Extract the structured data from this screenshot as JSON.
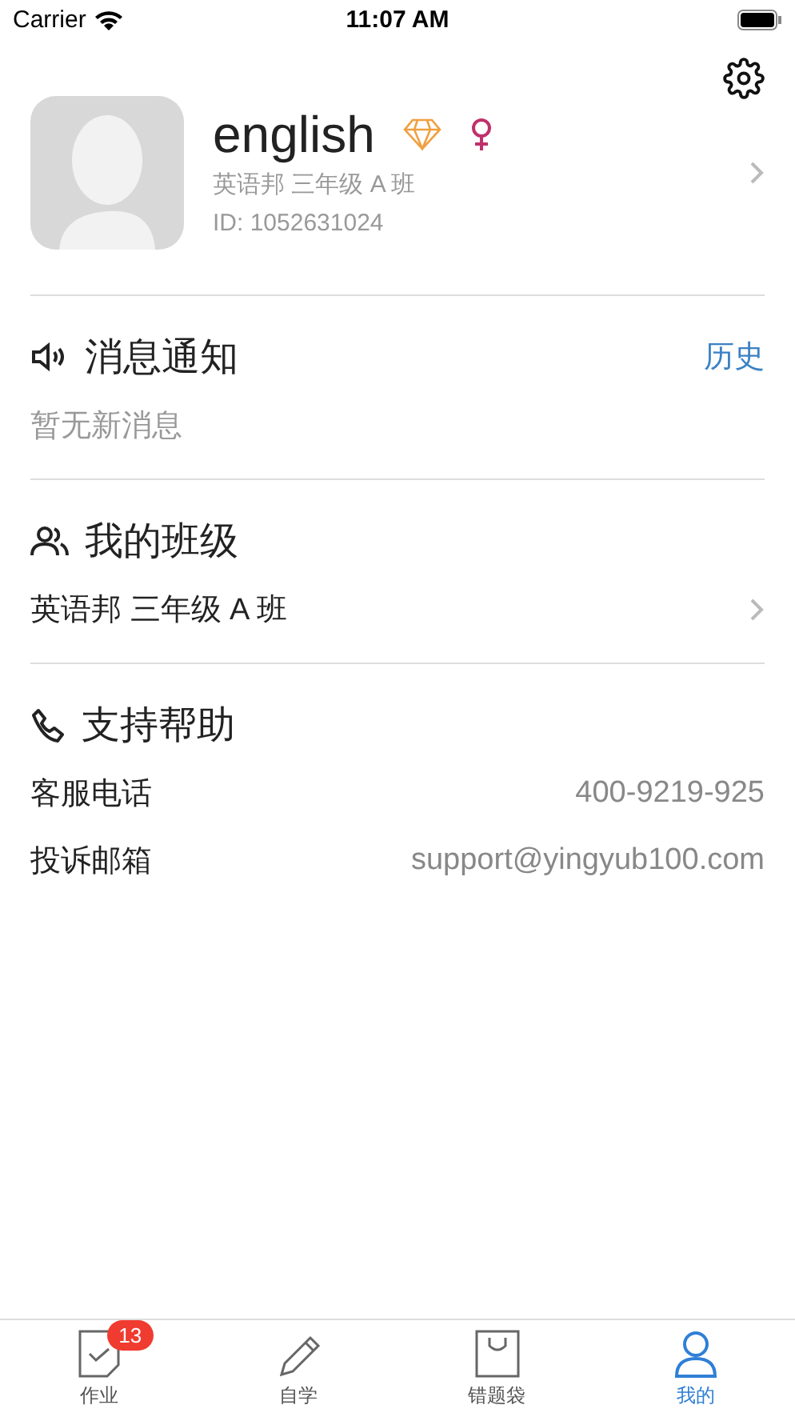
{
  "status_bar": {
    "carrier": "Carrier",
    "time": "11:07 AM"
  },
  "profile": {
    "name": "english",
    "class_name": "英语邦 三年级 A 班",
    "id": "ID: 1052631024"
  },
  "sections": [
    {
      "kind": "notice",
      "title": "消息通知",
      "link": "历史",
      "rows": [
        {
          "kind": "empty",
          "label": "暂无新消息"
        }
      ]
    },
    {
      "kind": "class",
      "title": "我的班级",
      "rows": [
        {
          "kind": "nav",
          "label": "英语邦 三年级 A 班"
        }
      ]
    },
    {
      "kind": "support",
      "title": "支持帮助",
      "rows": [
        {
          "kind": "pair",
          "label": "客服电话",
          "value": "400-9219-925"
        },
        {
          "kind": "pair",
          "label": "投诉邮箱",
          "value": "support@yingyub100.com"
        }
      ]
    }
  ],
  "tabs": [
    {
      "kind": "homework",
      "label": "作业",
      "badge": "13",
      "selected": false
    },
    {
      "kind": "study",
      "label": "自学",
      "selected": false
    },
    {
      "kind": "bag",
      "label": "错题袋",
      "selected": false
    },
    {
      "kind": "me",
      "label": "我的",
      "selected": true
    }
  ]
}
